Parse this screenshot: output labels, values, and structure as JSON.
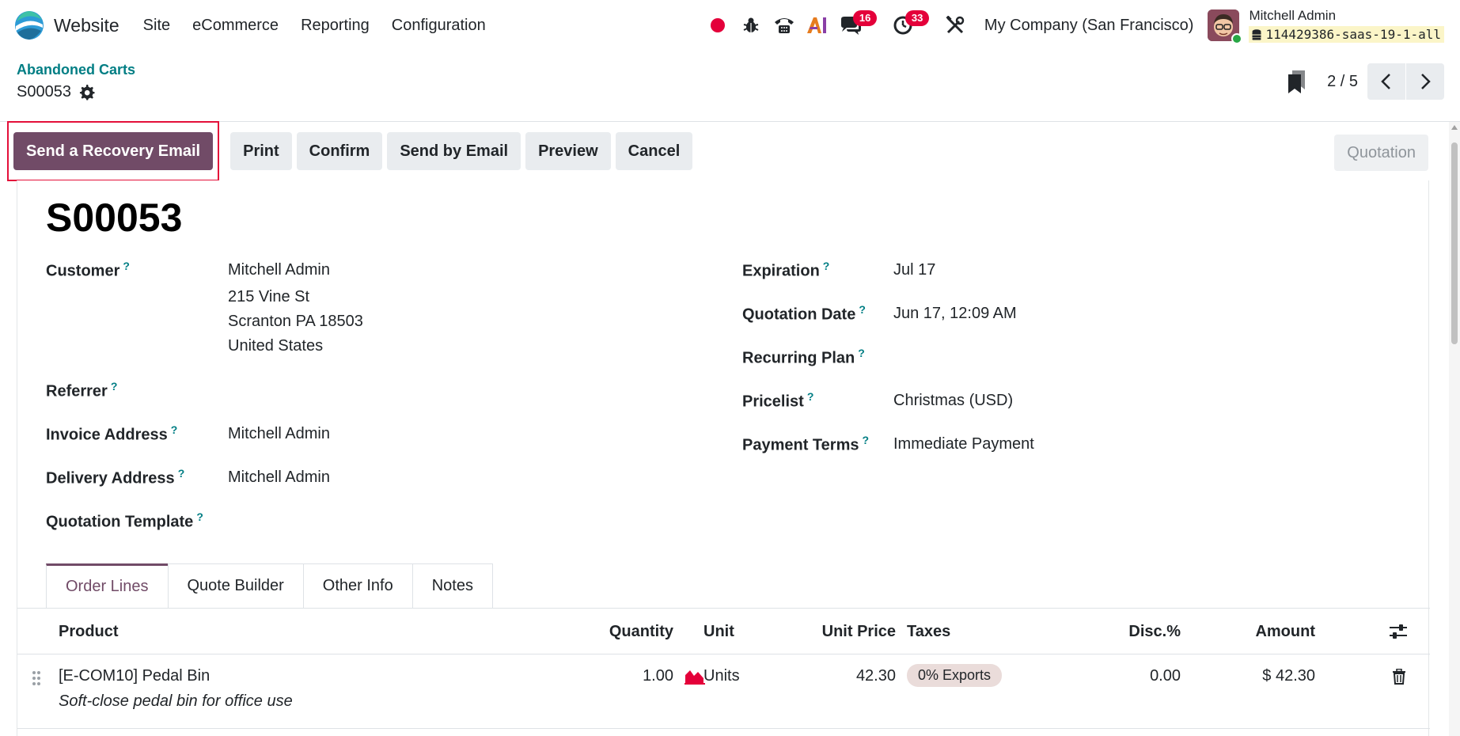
{
  "app": {
    "name": "Website",
    "menu": [
      "Site",
      "eCommerce",
      "Reporting",
      "Configuration"
    ],
    "company": "My Company (San Francisco)",
    "user_name": "Mitchell Admin",
    "database": "114429386-saas-19-1-all",
    "badges": {
      "messages": "16",
      "activities": "33"
    }
  },
  "breadcrumb": {
    "parent": "Abandoned Carts",
    "current": "S00053"
  },
  "pager": {
    "value": "2 / 5"
  },
  "buttons": {
    "recovery": "Send a Recovery Email",
    "print": "Print",
    "confirm": "Confirm",
    "send_email": "Send by Email",
    "preview": "Preview",
    "cancel": "Cancel"
  },
  "status": "Quotation",
  "form": {
    "title": "S00053",
    "labels": {
      "customer": "Customer",
      "referrer": "Referrer",
      "invoice_address": "Invoice Address",
      "delivery_address": "Delivery Address",
      "quotation_template": "Quotation Template",
      "expiration": "Expiration",
      "quotation_date": "Quotation Date",
      "recurring_plan": "Recurring Plan",
      "pricelist": "Pricelist",
      "payment_terms": "Payment Terms"
    },
    "tooltip": "?",
    "customer": {
      "name": "Mitchell Admin",
      "street": "215 Vine St",
      "city": "Scranton PA 18503",
      "country": "United States"
    },
    "invoice_address": "Mitchell Admin",
    "delivery_address": "Mitchell Admin",
    "expiration": "Jul 17",
    "quotation_date": "Jun 17, 12:09 AM",
    "pricelist": "Christmas (USD)",
    "payment_terms": "Immediate Payment"
  },
  "tabs": [
    "Order Lines",
    "Quote Builder",
    "Other Info",
    "Notes"
  ],
  "table": {
    "headers": {
      "product": "Product",
      "quantity": "Quantity",
      "unit": "Unit",
      "unit_price": "Unit Price",
      "taxes": "Taxes",
      "discount": "Disc.%",
      "amount": "Amount"
    },
    "rows": [
      {
        "product": "[E-COM10] Pedal Bin",
        "description": "Soft-close pedal bin for office use",
        "quantity": "1.00",
        "unit": "Units",
        "unit_price": "42.30",
        "taxes": "0% Exports",
        "discount": "0.00",
        "amount": "$ 42.30"
      }
    ]
  },
  "colors": {
    "primary": "#714b67",
    "link": "#017e84",
    "badge": "#e4003a",
    "highlight_border": "#e4103a"
  }
}
